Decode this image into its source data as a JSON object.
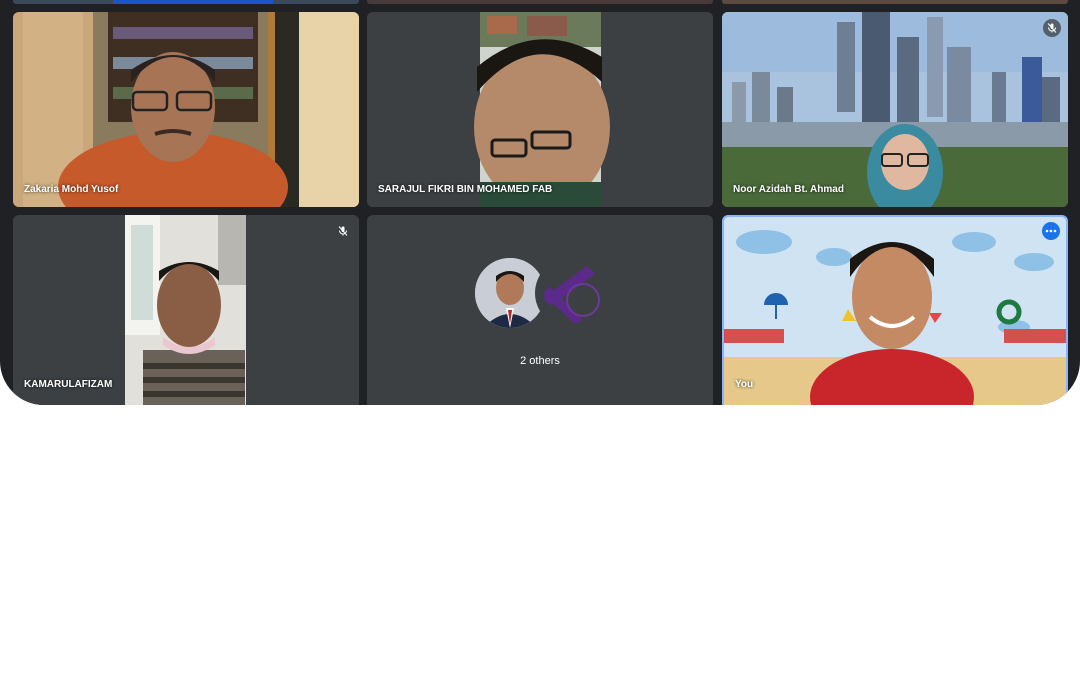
{
  "participants": [
    {
      "name": "Zakaria Mohd Yusof",
      "muted": false
    },
    {
      "name": "SARAJUL FIKRI BIN MOHAMED FAB",
      "muted": false
    },
    {
      "name": "Noor Azidah Bt. Ahmad",
      "muted": true
    },
    {
      "name": "KAMARULAFIZAM",
      "muted": true
    },
    {
      "name": "2 others",
      "muted": false
    },
    {
      "name": "You",
      "muted": false
    }
  ],
  "colors": {
    "background": "#202124",
    "tile": "#3c4043",
    "active_border": "#8ab4f8",
    "accent": "#1a73e8"
  },
  "icons": [
    "mic-off-icon",
    "more-options-icon"
  ]
}
